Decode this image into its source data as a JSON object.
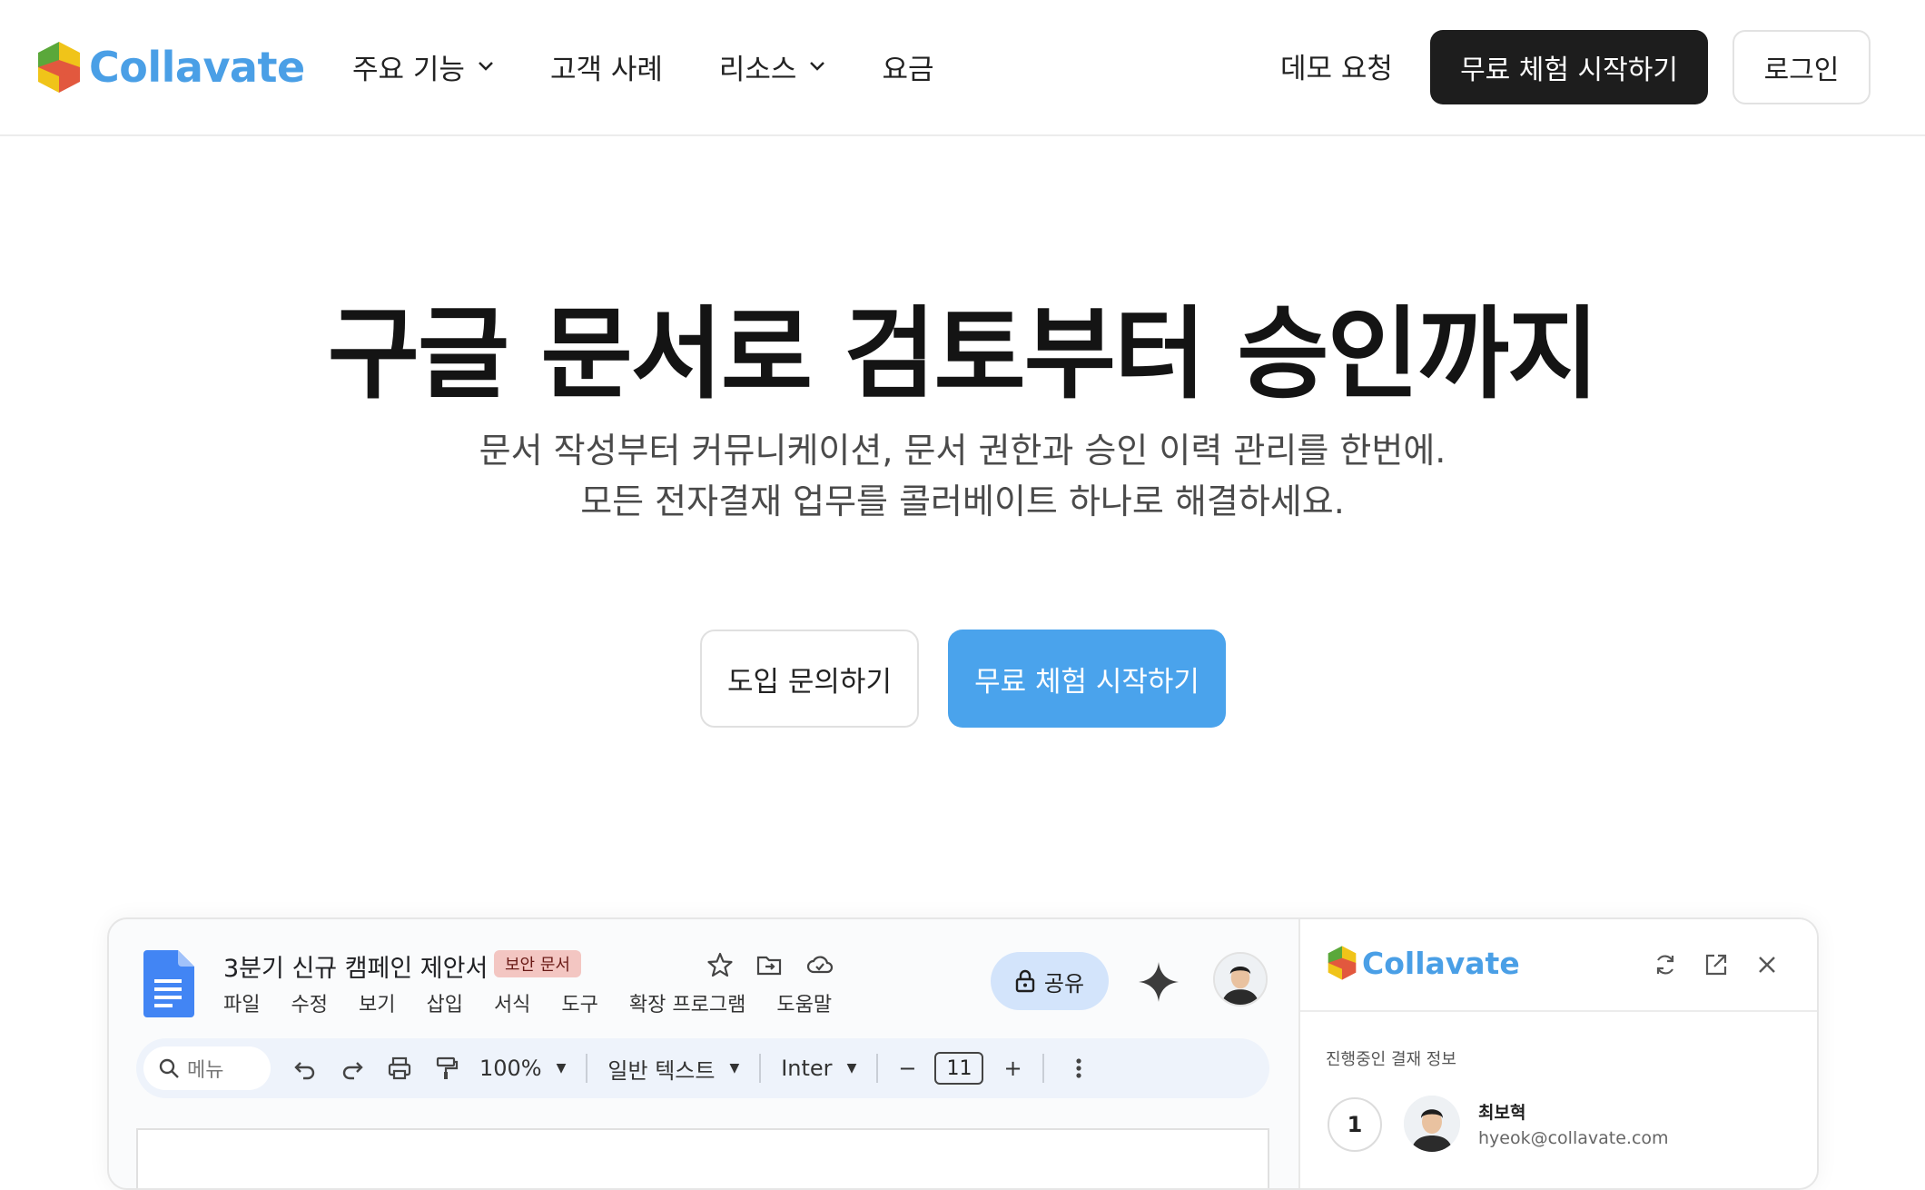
{
  "header": {
    "logo_text": "Collavate",
    "nav": [
      {
        "label": "주요 기능",
        "has_dropdown": true
      },
      {
        "label": "고객 사례",
        "has_dropdown": false
      },
      {
        "label": "리소스",
        "has_dropdown": true
      },
      {
        "label": "요금",
        "has_dropdown": false
      }
    ],
    "demo_label": "데모 요청",
    "trial_label": "무료 체험 시작하기",
    "login_label": "로그인"
  },
  "hero": {
    "title": "구글 문서로 검토부터 승인까지",
    "subtitle_line1": "문서 작성부터 커뮤니케이션, 문서 권한과 승인 이력 관리를 한번에.",
    "subtitle_line2": "모든 전자결재 업무를 콜러베이트 하나로 해결하세요.",
    "inquiry_label": "도입 문의하기",
    "trial_label": "무료 체험 시작하기"
  },
  "preview": {
    "doc_title": "3분기 신규 캠페인 제안서",
    "badge": "보안 문서",
    "menu": [
      "파일",
      "수정",
      "보기",
      "삽입",
      "서식",
      "도구",
      "확장 프로그램",
      "도움말"
    ],
    "share_label": "공유",
    "toolbar": {
      "search_placeholder": "메뉴",
      "zoom": "100%",
      "style": "일반 텍스트",
      "font": "Inter",
      "font_size": "11",
      "minus": "−",
      "plus": "+"
    },
    "side_panel": {
      "logo_text": "Collavate",
      "section_title": "진행중인 결재 정보",
      "step_number": "1",
      "approver_name": "최보혁",
      "approver_email": "hyeok@collavate.com"
    }
  },
  "colors": {
    "brand_blue": "#4a9fe6",
    "hero_button": "#4aa3ec",
    "dark_button": "#1d1d1d",
    "badge_bg": "#f3c6c2"
  }
}
